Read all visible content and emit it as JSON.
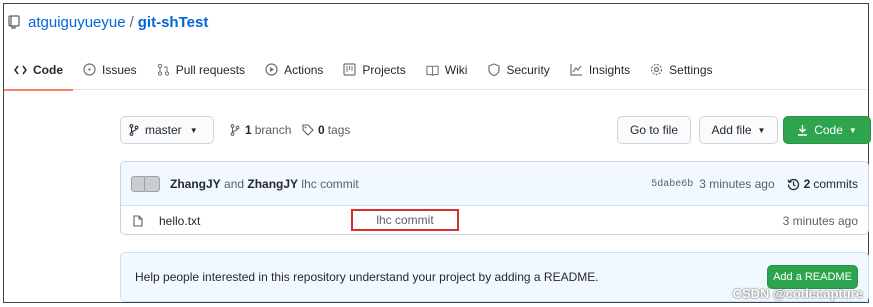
{
  "repo": {
    "owner": "atguiguyueyue",
    "separator": "/",
    "name": "git-shTest"
  },
  "tabs": [
    {
      "label": "Code",
      "icon": "code-icon",
      "active": true
    },
    {
      "label": "Issues",
      "icon": "issue-opened-icon"
    },
    {
      "label": "Pull requests",
      "icon": "git-pull-request-icon"
    },
    {
      "label": "Actions",
      "icon": "play-icon"
    },
    {
      "label": "Projects",
      "icon": "project-icon"
    },
    {
      "label": "Wiki",
      "icon": "book-icon"
    },
    {
      "label": "Security",
      "icon": "shield-icon"
    },
    {
      "label": "Insights",
      "icon": "graph-icon"
    },
    {
      "label": "Settings",
      "icon": "gear-icon"
    }
  ],
  "toolbar": {
    "branch": "master",
    "branch_count": "1",
    "branch_label": "branch",
    "tag_count": "0",
    "tag_label": "tags",
    "goto_file": "Go to file",
    "add_file": "Add file",
    "code": "Code"
  },
  "latest_commit": {
    "author1": "ZhangJY",
    "and": "and",
    "author2": "ZhangJY",
    "message": "lhc commit",
    "sha": "5dabe6b",
    "age": "3 minutes ago",
    "commit_count": "2",
    "commit_label": "commits"
  },
  "files": [
    {
      "name": "hello.txt",
      "message": "lhc commit",
      "age": "3 minutes ago"
    }
  ],
  "readme": {
    "text": "Help people interested in this repository understand your project by adding a README.",
    "button": "Add a README"
  },
  "watermark": "CSDN @codecapture",
  "colors": {
    "link": "#0366d6",
    "active_tab_underline": "#f9826c",
    "primary_button": "#2ea44f",
    "highlight_border": "#d9302c"
  }
}
